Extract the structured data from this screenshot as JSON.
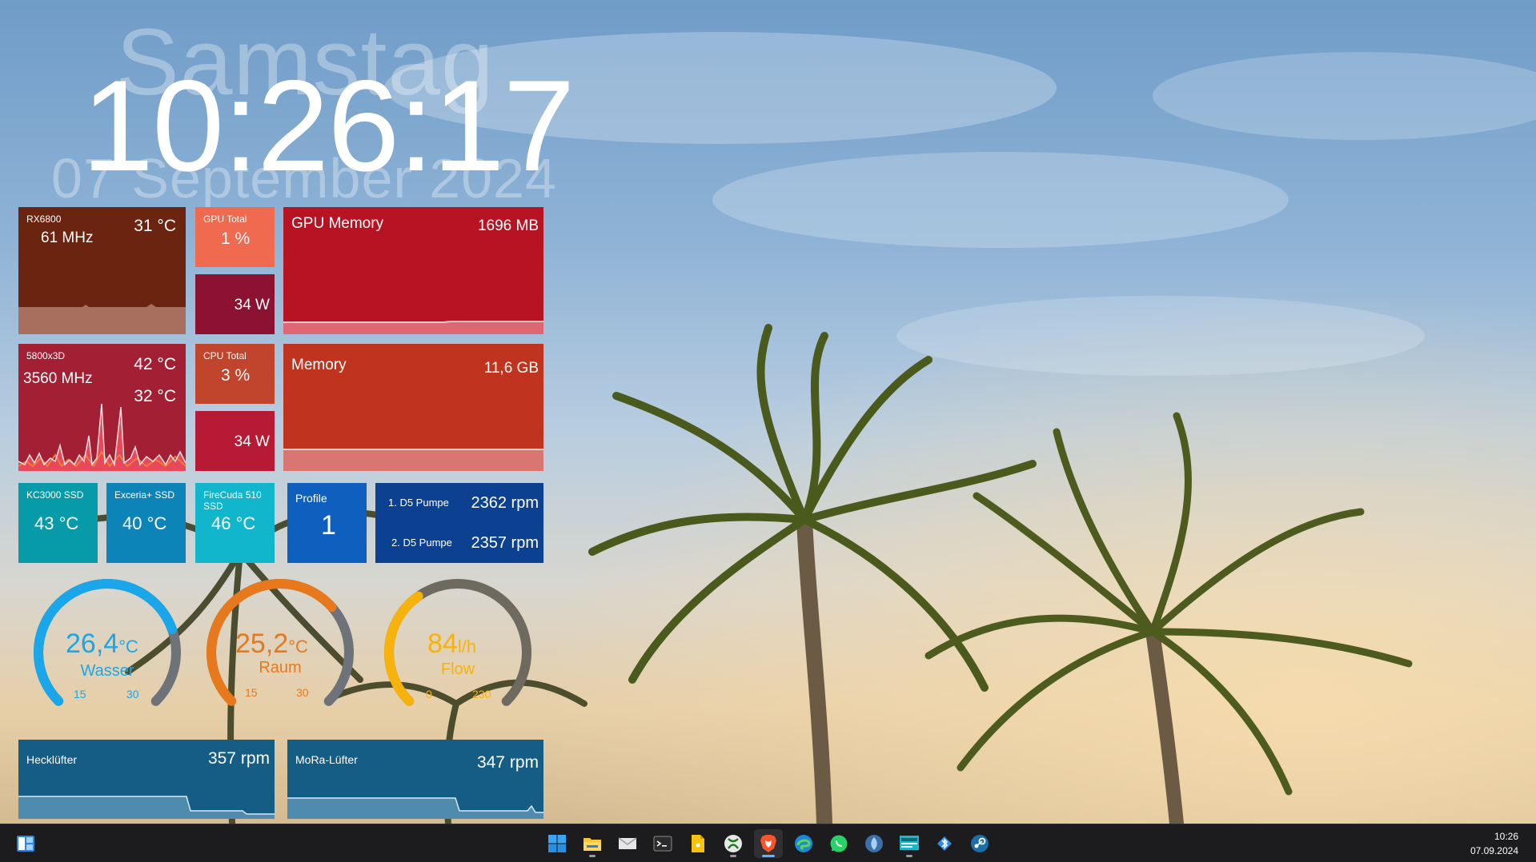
{
  "clock": {
    "day": "Samstag",
    "time": "10:26:17",
    "date": "07 September 2024"
  },
  "gpu": {
    "name": "RX6800",
    "temp": "31 °C",
    "clock": "61 MHz",
    "total_label": "GPU Total",
    "total_value": "1 %",
    "power": "34 W",
    "memory_label": "GPU Memory",
    "memory_value": "1696 MB"
  },
  "cpu": {
    "name": "5800x3D",
    "temp1": "42 °C",
    "temp2": "32 °C",
    "clock": "3560 MHz",
    "total_label": "CPU Total",
    "total_value": "3 %",
    "power": "34 W",
    "memory_label": "Memory",
    "memory_value": "11,6 GB"
  },
  "ssd": [
    {
      "name": "KC3000 SSD",
      "temp": "43 °C"
    },
    {
      "name": "Exceria+ SSD",
      "temp": "40 °C"
    },
    {
      "name": "FireCuda 510 SSD",
      "temp": "46 °C"
    }
  ],
  "profile": {
    "label": "Profile",
    "value": "1"
  },
  "pumps": [
    {
      "label": "1. D5 Pumpe",
      "value": "2362 rpm"
    },
    {
      "label": "2. D5 Pumpe",
      "value": "2357 rpm"
    }
  ],
  "gauges": [
    {
      "value": "26,4",
      "unit": "°C",
      "name": "Wasser",
      "min": "15",
      "max": "30",
      "level": 0.76,
      "color": "#1aa7ea",
      "track": "#6d7379"
    },
    {
      "value": "25,2",
      "unit": "°C",
      "name": "Raum",
      "min": "15",
      "max": "30",
      "level": 0.68,
      "color": "#e8781c",
      "track": "#6d7379"
    },
    {
      "value": "84",
      "unit": "l/h",
      "name": "Flow",
      "min": "0",
      "max": "230",
      "level": 0.37,
      "color": "#f7b20c",
      "track": "#6f6a5f"
    }
  ],
  "fans": [
    {
      "label": "Hecklüfter",
      "value": "357 rpm"
    },
    {
      "label": "MoRa-Lüfter",
      "value": "347 rpm"
    }
  ],
  "colors": {
    "gpu_tile": "#6b2410",
    "gpu_total": "#ef6a4f",
    "gpu_power": "#8c1232",
    "gpu_memory": "#b81322",
    "cpu_tile": "#a32034",
    "cpu_total": "#c1452c",
    "cpu_power": "#b61a35",
    "cpu_memory": "#c0331e",
    "ssd1": "#079aa8",
    "ssd2": "#0d84b8",
    "ssd3": "#12b6cc",
    "profile": "#0f5fbf",
    "pumps": "#0b4190",
    "fans": "#165d85"
  },
  "taskbar": {
    "apps": [
      "widgets-icon",
      "windows-start-icon",
      "file-explorer-icon",
      "mail-icon",
      "terminal-icon",
      "notes-icon",
      "xbox-icon",
      "brave-browser-icon",
      "edge-browser-icon",
      "whatsapp-icon",
      "hwinfo-icon",
      "monitor-app-icon",
      "bluetooth-app-icon",
      "steam-icon"
    ],
    "time": "10:26",
    "date": "07.09.2024"
  }
}
